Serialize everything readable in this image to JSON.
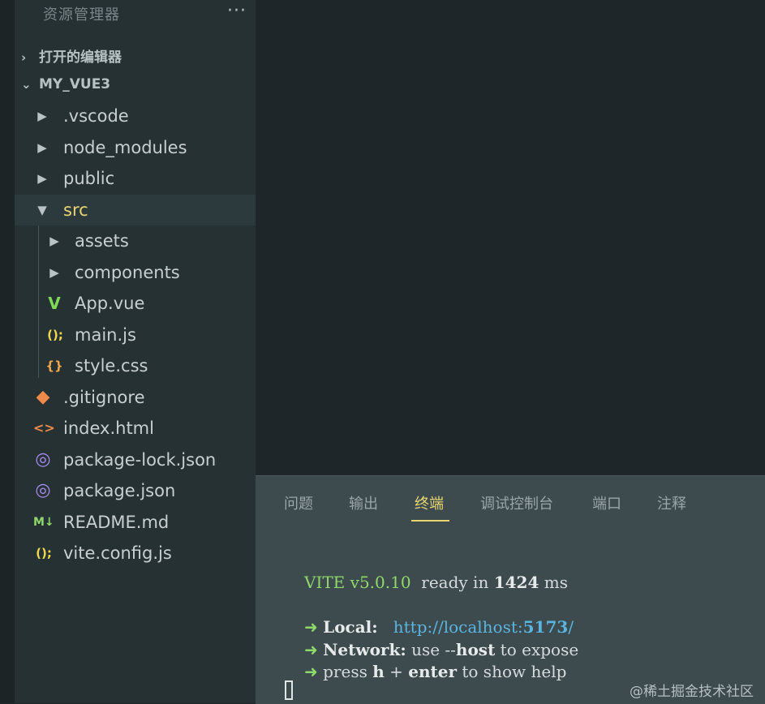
{
  "explorer": {
    "title": "资源管理器",
    "more": "···",
    "open_editors": "打开的编辑器",
    "project": "MY_VUE3"
  },
  "tree": [
    {
      "label": ".vscode"
    },
    {
      "label": "node_modules"
    },
    {
      "label": "public"
    },
    {
      "label": "src"
    },
    {
      "label": "assets"
    },
    {
      "label": "components"
    },
    {
      "label": "App.vue",
      "icon_glyph": "V"
    },
    {
      "label": "main.js",
      "icon_glyph": "();"
    },
    {
      "label": "style.css",
      "icon_glyph": "{}"
    },
    {
      "label": ".gitignore",
      "icon_glyph": "◆"
    },
    {
      "label": "index.html",
      "icon_glyph": "<>"
    },
    {
      "label": "package-lock.json",
      "icon_glyph": "◎"
    },
    {
      "label": "package.json",
      "icon_glyph": "◎"
    },
    {
      "label": "README.md",
      "icon_glyph": "M↓"
    },
    {
      "label": "vite.config.js",
      "icon_glyph": "();"
    }
  ],
  "icons": {
    "folder_closed": "▶",
    "folder_open": "▼",
    "section_chevron": "∨"
  },
  "panel": {
    "tabs": [
      {
        "label": "问题"
      },
      {
        "label": "输出"
      },
      {
        "label": "终端",
        "active": true
      },
      {
        "label": "调试控制台"
      },
      {
        "label": "端口"
      },
      {
        "label": "注释"
      }
    ]
  },
  "terminal": {
    "vite": "VITE v5.0.10",
    "ready": "ready in",
    "ready_ms": "1424",
    "ms": "ms",
    "arrow": "➜",
    "local_label": "Local:",
    "local_url": "http://localhost:",
    "local_port": "5173",
    "local_slash": "/",
    "network_label": "Network:",
    "network_use": "use",
    "network_flag": "--",
    "network_host": "host",
    "network_rest": "to expose",
    "press": "press",
    "press_h": "h",
    "press_plus": "+",
    "press_enter": "enter",
    "press_rest": "to show help"
  },
  "watermark": "@稀土掘金技术社区",
  "colors": {
    "sidebar_bg": "#263134",
    "editor_bg": "#1f2629",
    "panel_bg": "#3d4a4e",
    "accent_yellow": "#e8d672",
    "terminal_green": "#8fd96a",
    "terminal_blue": "#5ab5e0"
  }
}
